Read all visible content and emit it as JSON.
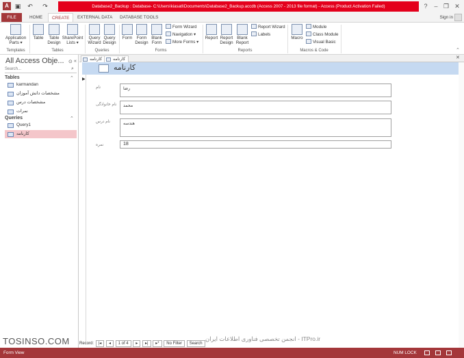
{
  "window": {
    "title": "Database2_Backup : Database- C:\\Users\\kiasati\\Documents\\Database2_Backup.accdb (Access 2007 - 2013 file format) -  Access (Product Activation Failed)",
    "app_icon": "A",
    "qat": [
      "save-icon",
      "undo-icon",
      "redo-icon"
    ],
    "help": "?",
    "sign_in": "Sign in"
  },
  "tabs": [
    {
      "label": "FILE"
    },
    {
      "label": "HOME"
    },
    {
      "label": "CREATE"
    },
    {
      "label": "EXTERNAL DATA"
    },
    {
      "label": "DATABASE TOOLS"
    }
  ],
  "ribbon": {
    "templates": {
      "label": "Templates",
      "buttons": [
        {
          "label1": "Application",
          "label2": "Parts ▾"
        }
      ]
    },
    "tables": {
      "label": "Tables",
      "buttons": [
        {
          "label1": "Table",
          "label2": ""
        },
        {
          "label1": "Table",
          "label2": "Design"
        },
        {
          "label1": "SharePoint",
          "label2": "Lists ▾"
        }
      ]
    },
    "queries": {
      "label": "Queries",
      "buttons": [
        {
          "label1": "Query",
          "label2": "Wizard"
        },
        {
          "label1": "Query",
          "label2": "Design"
        }
      ]
    },
    "forms": {
      "label": "Forms",
      "buttons": [
        {
          "label1": "Form",
          "label2": ""
        },
        {
          "label1": "Form",
          "label2": "Design"
        },
        {
          "label1": "Blank",
          "label2": "Form"
        }
      ],
      "small": [
        "Form Wizard",
        "Navigation ▾",
        "More Forms ▾"
      ]
    },
    "reports": {
      "label": "Reports",
      "buttons": [
        {
          "label1": "Report",
          "label2": ""
        },
        {
          "label1": "Report",
          "label2": "Design"
        },
        {
          "label1": "Blank",
          "label2": "Report"
        }
      ],
      "small": [
        "Report Wizard",
        "Labels"
      ]
    },
    "macros": {
      "label": "Macros & Code",
      "buttons": [
        {
          "label1": "Macro",
          "label2": ""
        }
      ],
      "small": [
        "Module",
        "Class Module",
        "Visual Basic"
      ]
    }
  },
  "nav": {
    "title": "All Access Obje...",
    "search_placeholder": "Search...",
    "categories": [
      {
        "name": "Tables",
        "items": [
          "karmandan",
          "مشخصات دانش آموزان",
          "مشخصات درس",
          "نمرات"
        ]
      },
      {
        "name": "Queries",
        "items": [
          "Query1",
          "کارنامه"
        ]
      }
    ],
    "selected": "کارنامه"
  },
  "document": {
    "tabs": [
      "کارنامه",
      "کارنامه"
    ],
    "form_title": "کارنامه",
    "fields": [
      {
        "label": "نام",
        "value": "رضا"
      },
      {
        "label": "نام خانوادگی",
        "value": "محمد"
      },
      {
        "label": "نام درس",
        "value": "هندسه"
      },
      {
        "label": "نمره",
        "value": "18"
      }
    ]
  },
  "record_nav": {
    "prefix": "Record:",
    "first": "|◂",
    "prev": "◂",
    "current": "1 of 4",
    "next": "▸",
    "last": "▸|",
    "new": "▸*",
    "filter": "No Filter",
    "search": "Search"
  },
  "status": {
    "left": "Form View",
    "numlock": "NUM LOCK"
  },
  "watermarks": {
    "left": "TOSINSO.COM",
    "right": "انجمن تخصصی فناوری اطلاعات ایران - ITPro.ir"
  }
}
